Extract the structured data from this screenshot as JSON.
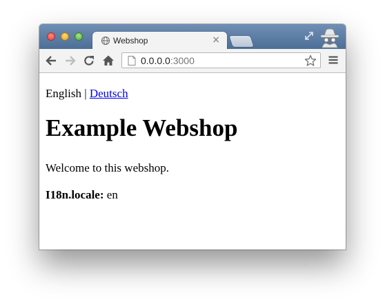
{
  "browser": {
    "tab": {
      "title": "Webshop",
      "close_label": "×"
    },
    "address_bar": {
      "host": "0.0.0.0",
      "port": ":3000"
    },
    "icons": {
      "back": "back-arrow-icon",
      "forward": "forward-arrow-icon",
      "reload": "reload-icon",
      "home": "home-icon",
      "page": "page-icon",
      "bookmark": "star-icon",
      "menu": "hamburger-menu-icon",
      "fullscreen": "fullscreen-icon",
      "incognito": "incognito-icon",
      "tab_favicon": "globe-icon"
    },
    "colors": {
      "titlebar": "#5a7aa3",
      "link": "#0000ee"
    }
  },
  "page": {
    "language_switcher": {
      "current": "English",
      "separator": "|",
      "other_link": "Deutsch"
    },
    "heading": "Example Webshop",
    "welcome": "Welcome to this webshop.",
    "locale": {
      "label": "I18n.locale:",
      "value": "en"
    }
  }
}
